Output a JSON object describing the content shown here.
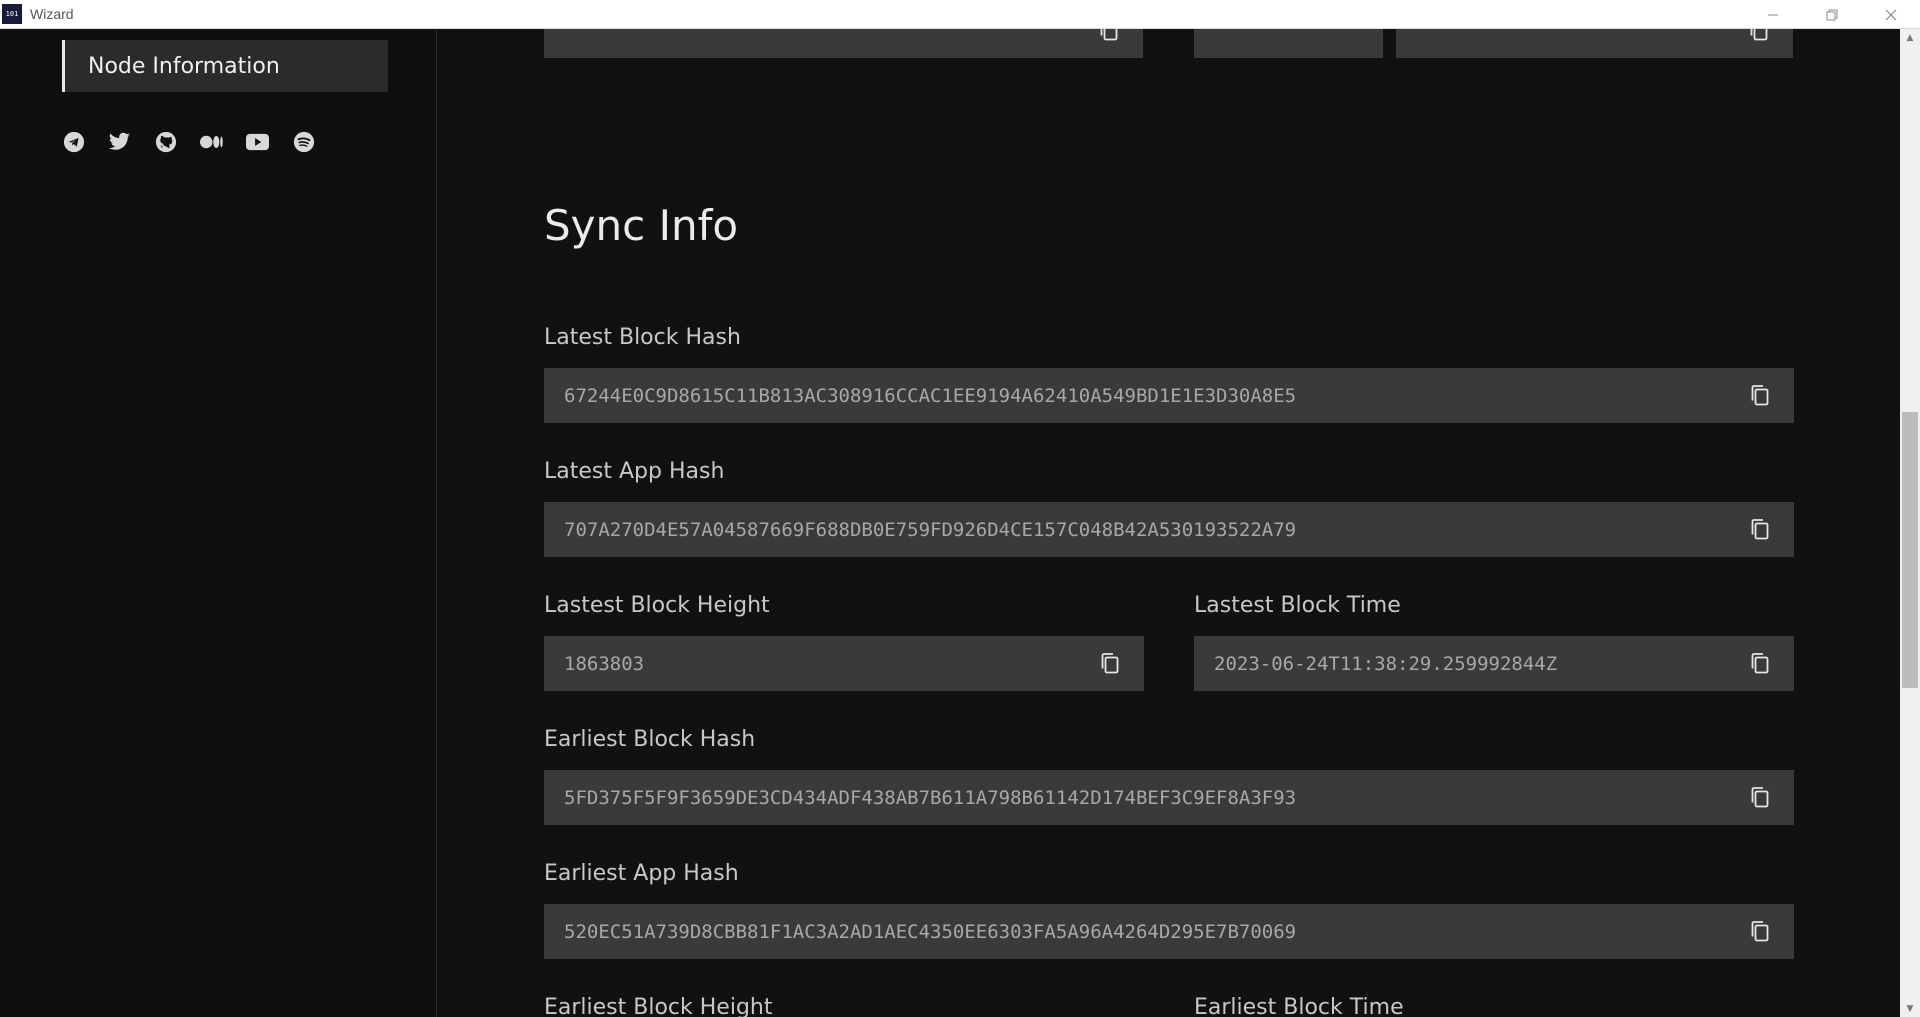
{
  "window": {
    "title": "Wizard",
    "icon_label": "101"
  },
  "sidebar": {
    "active_item": "Node Information",
    "social_icons": [
      "telegram-icon",
      "twitter-icon",
      "github-icon",
      "medium-icon",
      "youtube-icon",
      "spotify-icon"
    ]
  },
  "section": {
    "title": "Sync Info"
  },
  "fields": {
    "latest_block_hash": {
      "label": "Latest Block Hash",
      "value": "67244E0C9D8615C11B813AC308916CCAC1EE9194A62410A549BD1E1E3D30A8E5"
    },
    "latest_app_hash": {
      "label": "Latest App Hash",
      "value": "707A270D4E57A04587669F688DB0E759FD926D4CE157C048B42A530193522A79"
    },
    "latest_block_height": {
      "label": "Lastest Block Height",
      "value": "1863803"
    },
    "latest_block_time": {
      "label": "Lastest Block Time",
      "value": "2023-06-24T11:38:29.259992844Z"
    },
    "earliest_block_hash": {
      "label": "Earliest Block Hash",
      "value": "5FD375F5F9F3659DE3CD434ADF438AB7B611A798B61142D174BEF3C9EF8A3F93"
    },
    "earliest_app_hash": {
      "label": "Earliest App Hash",
      "value": "520EC51A739D8CBB81F1AC3A2AD1AEC4350EE6303FA5A96A4264D295E7B70069"
    },
    "earliest_block_height": {
      "label": "Earliest Block Height"
    },
    "earliest_block_time": {
      "label": "Earliest Block Time"
    }
  },
  "colors": {
    "background": "#111111",
    "field_background": "#3a3a3a",
    "text": "#a8a8a8"
  }
}
